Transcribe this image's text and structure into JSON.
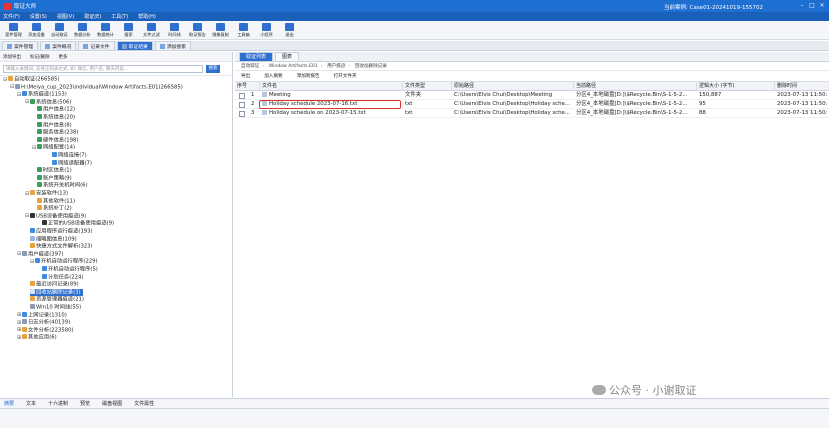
{
  "app": {
    "title": "取证大师",
    "case_label": "当前案例:",
    "case_name": "Case01-20241019-155702"
  },
  "menu": [
    "文件(F)",
    "设置(S)",
    "视图(V)",
    "取证(E)",
    "工具(T)",
    "帮助(H)"
  ],
  "toolbar": [
    "案件管理",
    "添加设备",
    "自动取证",
    "数据分析",
    "数据统计",
    "搜索",
    "文件过滤",
    "时间线",
    "取证报告",
    "镜像复制",
    "工具箱",
    "小程序",
    "退出"
  ],
  "tabs": [
    "案件管理",
    "案件概况",
    "记录文件",
    "取证结果",
    "添加搜索"
  ],
  "left": {
    "toolbar": [
      "添加导出",
      "标记/删除",
      "更多"
    ],
    "search_placeholder": "请输入关键词, 支持正则表达式, 如: 微信, 用户名, 聊天内容...",
    "search_button": "搜索",
    "tree": [
      "自动取证(266585)",
      "H:\\Meiya_cup_2023\\individual\\Window Artifacts.E01(266585)",
      "系统痕迹(1153)",
      "系统信息(506)",
      "用户信息(12)",
      "系统信息(20)",
      "用户信息(8)",
      "服务信息(238)",
      "硬件信息(198)",
      "网络配置(14)",
      "网络连接(7)",
      "网络适配器(7)",
      "时区信息(1)",
      "账户策略(9)",
      "系统开关机时间(6)",
      "安装软件(13)",
      "其他软件(11)",
      "系统补丁(2)",
      "USB设备使用痕迹(9)",
      "正常的USB设备使用痕迹(9)",
      "应用程序运行痕迹(193)",
      "缩略图信息(109)",
      "快捷方式文件解析(323)",
      "用户痕迹(397)",
      "开机自动运行程序(229)",
      "开机自动运行程序(5)",
      "计划任务(224)",
      "最近访问记录(89)",
      "回收站删除记录(3)",
      "资源管理器痕迹(21)",
      "Win10 时间线(55)",
      "上网记录(1310)",
      "日志分析(40139)",
      "文件分析(223580)",
      "其他应用(6)"
    ]
  },
  "right": {
    "tabs": [
      "取证列表",
      "图表"
    ],
    "breadcrumb": [
      "自动取证",
      "Window Artifacts.E01",
      "用户痕迹",
      "回收站删除记录"
    ],
    "buttons": [
      "导出",
      "加入摘要",
      "添加到报告",
      "打开文件夹"
    ],
    "columns": [
      "序号",
      "文件名",
      "文件类型",
      "原始路径",
      "当前路径",
      "逻辑大小 (字节)",
      "删除时间"
    ],
    "rows": [
      {
        "no": "1",
        "name": "Meeting",
        "type": "文件夹",
        "orig": "C:\\Users\\Elvis Chui\\Desktop\\Meeting",
        "cur": "分区4_本地磁盘[D:]\\$Recycle.Bin\\S-1-5-2...",
        "size": "150,887",
        "time": "2023-07-13 11:50:"
      },
      {
        "no": "2",
        "name": "Holiday schedule 2023-07-16.txt",
        "type": "txt",
        "orig": "C:\\Users\\Elvis Chui\\Desktop\\Holiday sche...",
        "cur": "分区4_本地磁盘[D:]\\$Recycle.Bin\\S-1-5-2...",
        "size": "95",
        "time": "2023-07-13 11:50:"
      },
      {
        "no": "3",
        "name": "Holiday schedule on 2023-07-15.txt",
        "type": "txt",
        "orig": "C:\\Users\\Elvis Chui\\Desktop\\Holiday sche...",
        "cur": "分区4_本地磁盘[D:]\\$Recycle.Bin\\S-1-5-2...",
        "size": "88",
        "time": "2023-07-13 11:50:"
      }
    ]
  },
  "bottom_tabs": [
    "摘要",
    "文本",
    "十六进制",
    "预览",
    "磁盘视图",
    "文件属性"
  ],
  "watermark": "公众号 · 小谢取证",
  "colors": {
    "accent": "#2f6fd0",
    "highlight": "#e2302b"
  }
}
